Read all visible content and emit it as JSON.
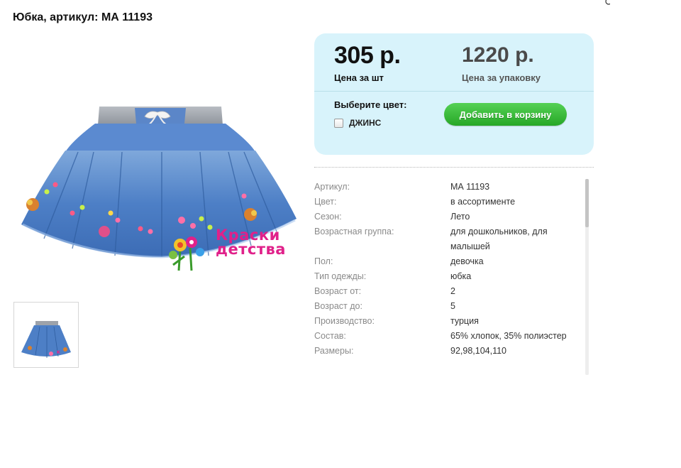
{
  "page": {
    "title": "Юбка, артикул: МА 11193"
  },
  "brand": {
    "line1": "Краски",
    "line2": "детства"
  },
  "price": {
    "unit_value": "305 р.",
    "unit_label": "Цена за шт",
    "pack_value": "1220 р.",
    "pack_label": "Цена за упаковку"
  },
  "color_select": {
    "label": "Выберите цвет:",
    "option": "ДЖИНС",
    "checked": false
  },
  "cart_button": {
    "label": "Добавить в корзину",
    "color": "#34b834"
  },
  "specs": [
    {
      "key": "Артикул:",
      "value": "МА 11193"
    },
    {
      "key": "Цвет:",
      "value": "в ассортименте"
    },
    {
      "key": "Сезон:",
      "value": "Лето"
    },
    {
      "key": "Возрастная группа:",
      "value": "для дошкольников, для малышей"
    },
    {
      "key": "Пол:",
      "value": "девочка"
    },
    {
      "key": "Тип одежды:",
      "value": "юбка"
    },
    {
      "key": "Возраст от:",
      "value": "2"
    },
    {
      "key": "Возраст до:",
      "value": "5"
    },
    {
      "key": "Производство:",
      "value": "турция"
    },
    {
      "key": "Состав:",
      "value": "65% хлопок, 35% полиэстер"
    },
    {
      "key": "Размеры:",
      "value": "92,98,104,110"
    }
  ],
  "colors": {
    "price_box_bg": "#d8f3fb",
    "accent_pink": "#e0218a"
  }
}
